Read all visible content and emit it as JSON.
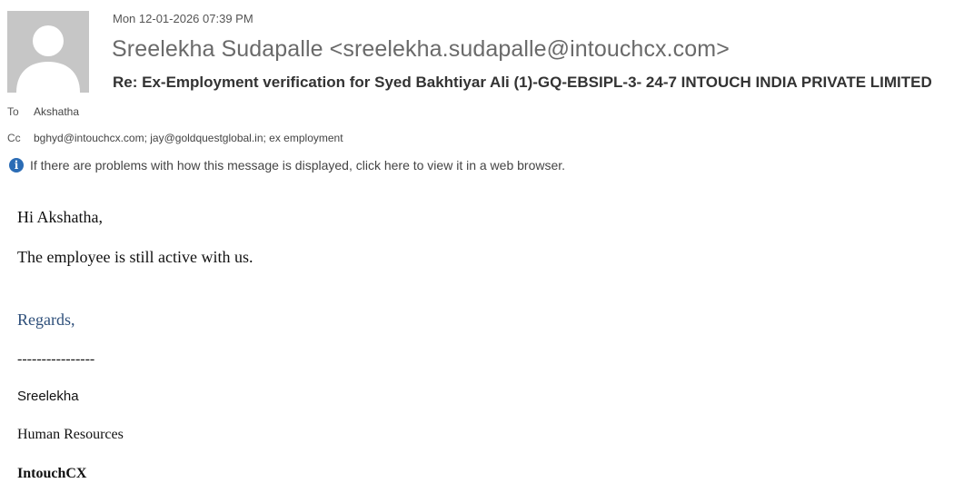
{
  "message": {
    "date": "Mon 12-01-2026 07:39 PM",
    "from": "Sreelekha Sudapalle <sreelekha.sudapalle@intouchcx.com>",
    "subject": "Re: Ex-Employment verification for Syed Bakhtiyar Ali (1)-GQ-EBSIPL-3- 24-7 INTOUCH INDIA PRIVATE LIMITED",
    "to_label": "To",
    "to_value": "Akshatha",
    "cc_label": "Cc",
    "cc_value": "bghyd@intouchcx.com; jay@goldquestglobal.in; ex employment"
  },
  "infobar": {
    "icon": "info-icon",
    "text": "If there are problems with how this message is displayed, click here to view it in a web browser."
  },
  "body": {
    "greeting": "Hi Akshatha,",
    "line1": "The employee is still active with us.",
    "regards": "Regards,",
    "separator": "----------------",
    "name": "Sreelekha",
    "department": "Human Resources",
    "company": "IntouchCX"
  },
  "colors": {
    "info_icon": "#2b6cb5",
    "regards": "#2e4f7a",
    "avatar_bg": "#c6c6c6"
  }
}
